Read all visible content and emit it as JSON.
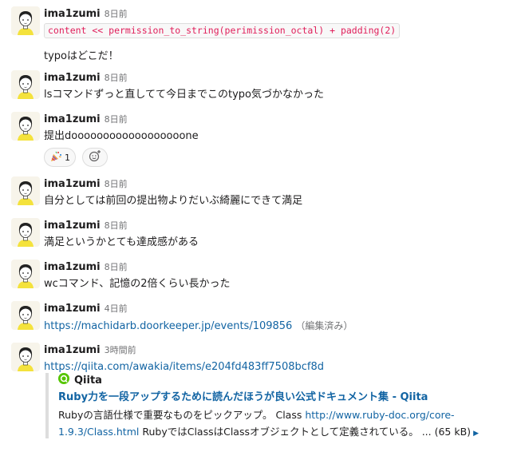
{
  "messages": [
    {
      "author": "ima1zumi",
      "time": "8日前",
      "code": "content << permission_to_string(perimission_octal) + padding(2)",
      "text": "typoはどこだ！"
    },
    {
      "author": "ima1zumi",
      "time": "8日前",
      "text": "lsコマンドずっと直してて今日までこのtypo気づかなかった"
    },
    {
      "author": "ima1zumi",
      "time": "8日前",
      "text": "提出doooooooooooooooooone",
      "reactions": [
        {
          "emoji": "party-popper",
          "count": "1"
        }
      ]
    },
    {
      "author": "ima1zumi",
      "time": "8日前",
      "text": "自分としては前回の提出物よりだいぶ綺麗にできて満足"
    },
    {
      "author": "ima1zumi",
      "time": "8日前",
      "text": "満足というかとても達成感がある"
    },
    {
      "author": "ima1zumi",
      "time": "8日前",
      "text": "wcコマンド、記憶の2倍くらい長かった"
    },
    {
      "author": "ima1zumi",
      "time": "4日前",
      "link": "https://machidarb.doorkeeper.jp/events/109856",
      "edited": "（編集済み）"
    },
    {
      "author": "ima1zumi",
      "time": "3時間前",
      "link": "https://qiita.com/awakia/items/e204fd483ff7508bcf8d",
      "attachment": {
        "site": "Qiita",
        "title": "Ruby力を一段アップするために読んだほうが良い公式ドキュメント集 - Qiita",
        "desc_before": "Rubyの言語仕様で重要なものをピックアップ。 Class ",
        "desc_link_1": "http://www.ruby-doc.org/core-",
        "desc_link_2": "1.9.3/Class.html",
        "desc_after": " RubyではClassはClassオブジェクトとして定義されている。 ... (65 kB)"
      }
    }
  ],
  "colors": {
    "link": "#1264a3",
    "code": "#e01e5a",
    "avatar_shirt": "#f4e23c",
    "qiita": "#55c500"
  }
}
